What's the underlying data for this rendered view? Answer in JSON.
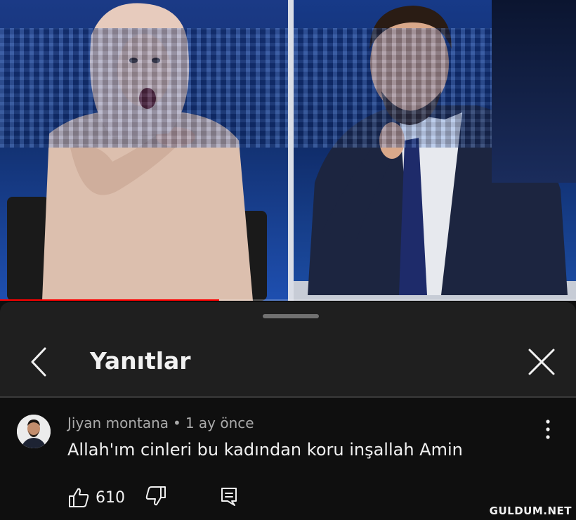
{
  "video": {
    "progress_fraction": 0.38,
    "progress_color": "#ff0000"
  },
  "sheet": {
    "title": "Yanıtlar",
    "back_icon": "chevron-left-icon",
    "close_icon": "close-icon"
  },
  "comment": {
    "author": "Jiyan montana",
    "separator": "•",
    "time": "1 ay önce",
    "text": "Allah'ım cinleri bu kadından koru inşallah Amin",
    "like_count": "610",
    "icons": [
      "thumb-up-icon",
      "thumb-down-icon",
      "reply-icon",
      "more-vert-icon"
    ]
  },
  "watermark": "GULDUM.NET"
}
